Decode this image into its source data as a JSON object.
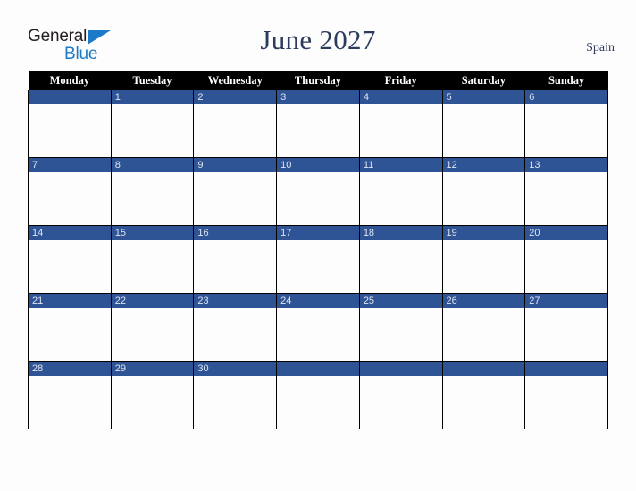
{
  "brand": {
    "name_part1": "General",
    "name_part2": "Blue",
    "triangle_color": "#1c7ac9",
    "text_color": "#231f20"
  },
  "header": {
    "title": "June 2027",
    "country": "Spain",
    "title_color": "#2c3a5c"
  },
  "calendar": {
    "weekday_headers": [
      "Monday",
      "Tuesday",
      "Wednesday",
      "Thursday",
      "Friday",
      "Saturday",
      "Sunday"
    ],
    "header_background": "#000000",
    "header_text_color": "#ffffff",
    "daynum_background": "#2f5496",
    "daynum_text_color": "#dfe5f0",
    "cell_background": "#fdfdfd",
    "grid_line_color": "#000000",
    "weeks": [
      [
        "",
        "1",
        "2",
        "3",
        "4",
        "5",
        "6"
      ],
      [
        "7",
        "8",
        "9",
        "10",
        "11",
        "12",
        "13"
      ],
      [
        "14",
        "15",
        "16",
        "17",
        "18",
        "19",
        "20"
      ],
      [
        "21",
        "22",
        "23",
        "24",
        "25",
        "26",
        "27"
      ],
      [
        "28",
        "29",
        "30",
        "",
        "",
        "",
        ""
      ]
    ]
  }
}
